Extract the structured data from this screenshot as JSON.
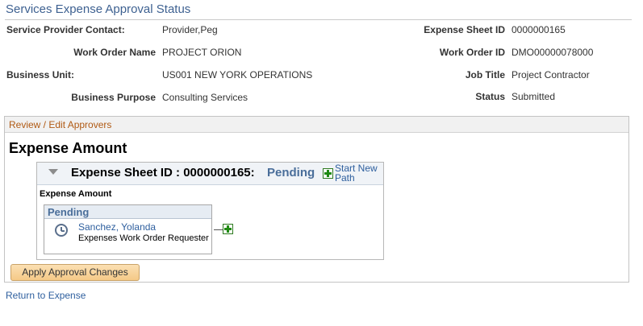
{
  "page": {
    "title": "Services Expense Approval Status"
  },
  "header_fields": {
    "service_provider_contact": {
      "label": "Service Provider Contact:",
      "value": "Provider,Peg"
    },
    "work_order_name": {
      "label": "Work Order Name",
      "value": "PROJECT ORION"
    },
    "business_unit": {
      "label": "Business Unit:",
      "value": "US001 NEW YORK OPERATIONS"
    },
    "business_purpose": {
      "label": "Business Purpose",
      "value": "Consulting Services"
    },
    "expense_sheet_id": {
      "label": "Expense Sheet ID",
      "value": "0000000165"
    },
    "work_order_id": {
      "label": "Work Order ID",
      "value": "DMO00000078000"
    },
    "job_title": {
      "label": "Job Title",
      "value": "Project Contractor"
    },
    "status": {
      "label": "Status",
      "value": "Submitted"
    }
  },
  "approvers": {
    "header": "Review / Edit Approvers",
    "section_title": "Expense Amount",
    "sheet": {
      "title": "Expense Sheet ID : 0000000165:",
      "status": "Pending",
      "start_new_path": "Start New Path",
      "sub_label": "Expense Amount",
      "step": {
        "status": "Pending",
        "approver_name": "Sanchez, Yolanda",
        "approver_role": "Expenses Work Order Requester"
      }
    },
    "icons": {
      "collapse": "collapse-triangle-icon",
      "add": "add-plus-icon",
      "pending": "clock-icon"
    },
    "apply_button": "Apply Approval Changes"
  },
  "footer": {
    "return_link": "Return to Expense"
  }
}
